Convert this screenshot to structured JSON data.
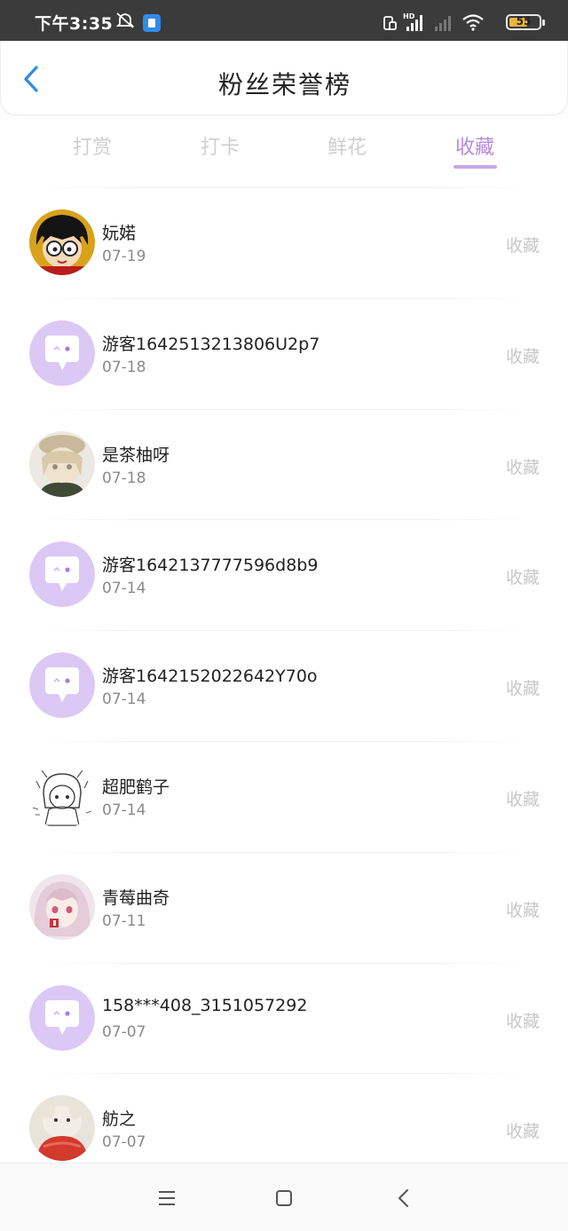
{
  "status_bar": {
    "time": "下午3:35",
    "icons": [
      "mute-icon",
      "app-notification-icon",
      "screen-rotate-icon",
      "hd-signal-icon",
      "signal-empty-icon",
      "wifi-icon"
    ],
    "battery_level": "55"
  },
  "header": {
    "title": "粉丝荣誉榜",
    "back_icon": "chevron-left-icon"
  },
  "tabs": [
    {
      "label": "打赏",
      "active": false
    },
    {
      "label": "打卡",
      "active": false
    },
    {
      "label": "鲜花",
      "active": false
    },
    {
      "label": "收藏",
      "active": true
    }
  ],
  "colors": {
    "accent": "#b58bd9",
    "underline": "#c9a7ea",
    "default_avatar_bg": "#dcc8f5",
    "status_bar_bg": "#3b3b3b"
  },
  "fans": [
    {
      "name": "妧婼",
      "date": "07-19",
      "action": "收藏",
      "avatar": "cartoon-boy-glasses-avatar"
    },
    {
      "name": "游客1642513213806U2p7",
      "date": "07-18",
      "action": "收藏",
      "avatar": "default-chat-bubble-avatar"
    },
    {
      "name": "是茶柚呀",
      "date": "07-18",
      "action": "收藏",
      "avatar": "anime-girl-hat-avatar"
    },
    {
      "name": "游客1642137777596d8b9",
      "date": "07-14",
      "action": "收藏",
      "avatar": "default-chat-bubble-avatar"
    },
    {
      "name": "游客1642152022642Y70o",
      "date": "07-14",
      "action": "收藏",
      "avatar": "default-chat-bubble-avatar"
    },
    {
      "name": "超肥鹤子",
      "date": "07-14",
      "action": "收藏",
      "avatar": "sketch-girl-avatar"
    },
    {
      "name": "青莓曲奇",
      "date": "07-11",
      "action": "收藏",
      "avatar": "pink-hair-girl-avatar"
    },
    {
      "name": "158***408_3151057292",
      "date": "07-07",
      "action": "收藏",
      "avatar": "default-chat-bubble-avatar"
    },
    {
      "name": "舫之",
      "date": "07-07",
      "action": "收藏",
      "avatar": "plush-toy-avatar"
    }
  ],
  "nav_bar": {
    "buttons": [
      "menu-icon",
      "home-square-icon",
      "back-triangle-icon"
    ]
  }
}
